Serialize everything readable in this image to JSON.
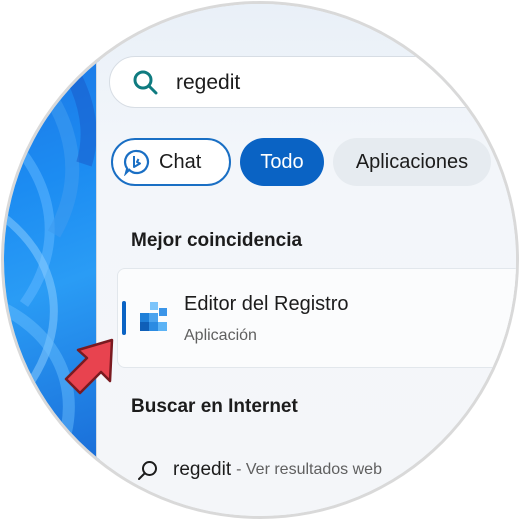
{
  "search": {
    "value": "regedit",
    "icon": "search-icon"
  },
  "filters": [
    {
      "label": "Chat",
      "icon": "bing-chat-icon",
      "state": "outlined"
    },
    {
      "label": "Todo",
      "state": "selected"
    },
    {
      "label": "Aplicaciones",
      "state": "default"
    }
  ],
  "best_match": {
    "heading": "Mejor coincidencia",
    "title": "Editor del Registro",
    "subtitle": "Aplicación",
    "icon": "registry-editor-icon"
  },
  "web_search": {
    "heading": "Buscar en Internet",
    "query": "regedit",
    "suffix": "- Ver resultados web",
    "icon": "search-icon"
  },
  "colors": {
    "accent": "#0a63c4",
    "arrow": "#e8434f"
  }
}
